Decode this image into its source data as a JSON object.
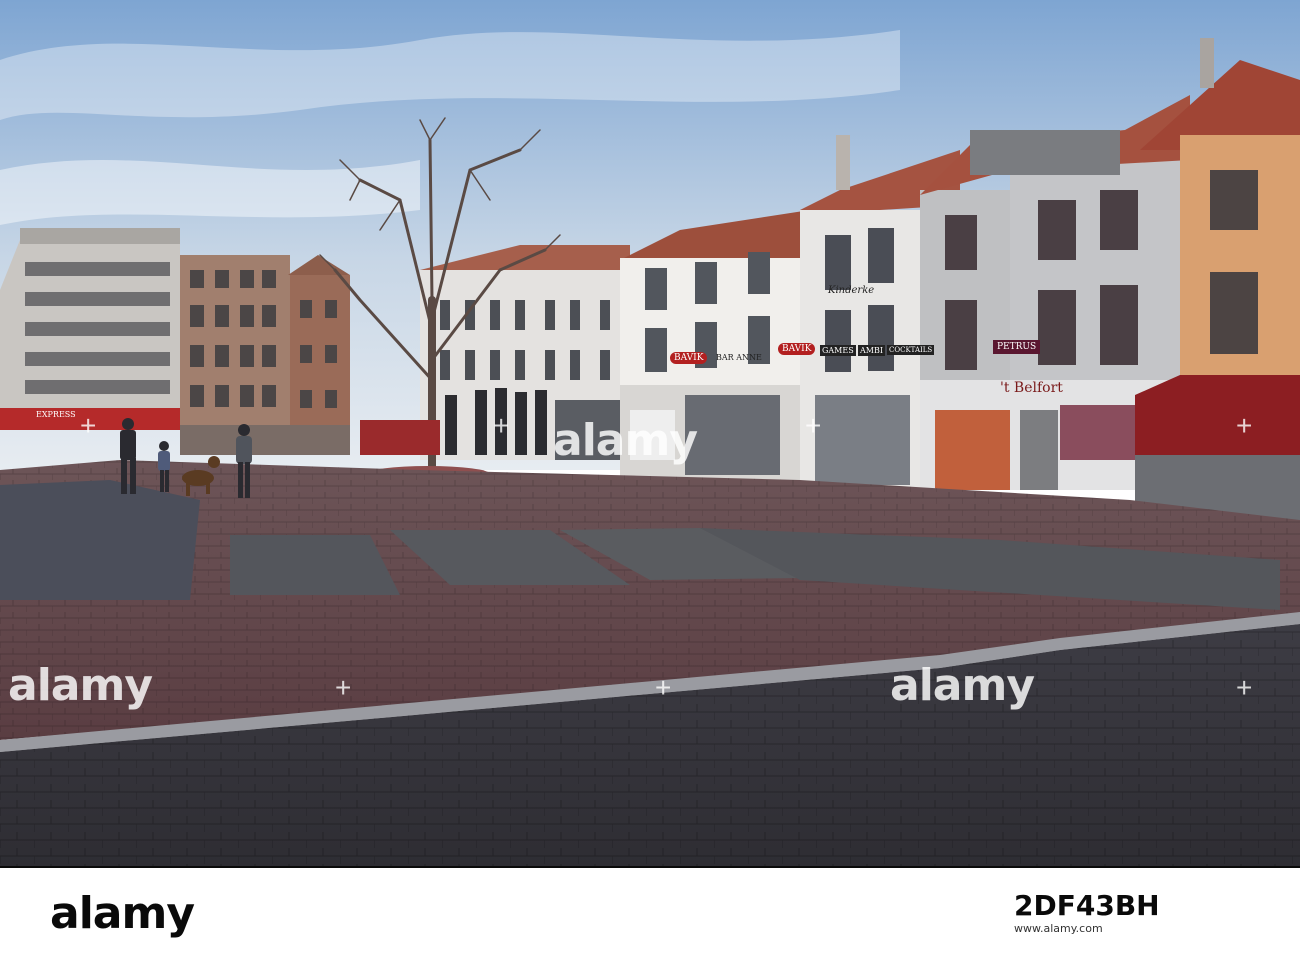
{
  "image": {
    "description_free": true
  },
  "signs": {
    "bavik_left": "BAVIK",
    "bavik_right": "BAVIK",
    "ban_anne": "BAR ANNE",
    "games": "GAMES",
    "ambi": "AMBI",
    "cocktails": "COCKTAILS",
    "kinderke": "Kinderke",
    "petrus": "PETRUS",
    "belfort": "'t Belfort",
    "carrefour": "EXPRESS"
  },
  "watermarks": {
    "center": "alamy",
    "left": "alamy",
    "middle": "alamy"
  },
  "footer": {
    "logo": "alamy",
    "image_id": "2DF43BH",
    "caption": "www.alamy.com"
  },
  "colors": {
    "sky_top": "#8fb3d9",
    "sky_bottom": "#dfe7ef",
    "brick": "#7a4a4a",
    "road": "#3a3a40",
    "awning": "#8a1c20"
  }
}
